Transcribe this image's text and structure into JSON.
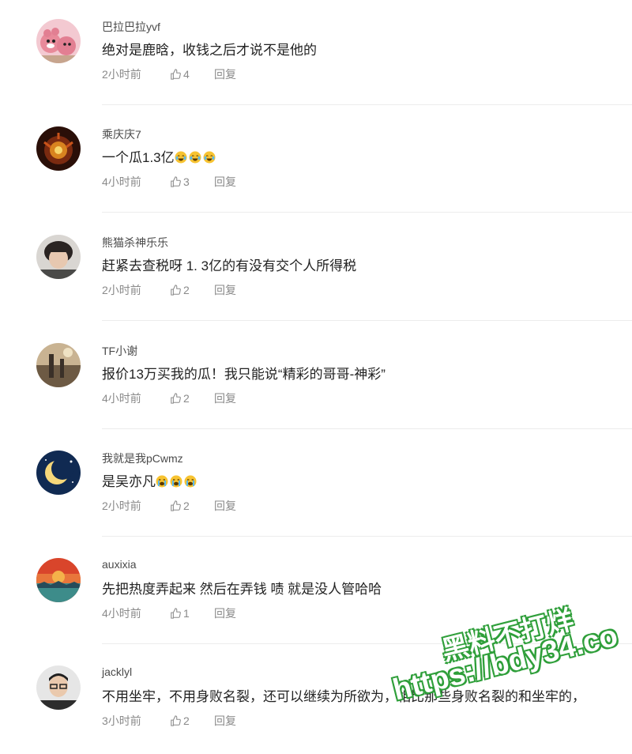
{
  "comments": [
    {
      "username": "巴拉巴拉yvf",
      "text": "绝对是鹿晗，收钱之后才说不是他的",
      "emoji_count": 0,
      "time": "2小时前",
      "likes": "4",
      "reply_label": "回复"
    },
    {
      "username": "乘庆庆7",
      "text": "一个瓜1.3亿",
      "emoji_count": 3,
      "time": "4小时前",
      "likes": "3",
      "reply_label": "回复"
    },
    {
      "username": "熊猫杀神乐乐",
      "text": "赶紧去查税呀 1. 3亿的有没有交个人所得税",
      "emoji_count": 0,
      "time": "2小时前",
      "likes": "2",
      "reply_label": "回复"
    },
    {
      "username": "TF小谢",
      "text": "报价13万买我的瓜！我只能说“精彩的哥哥-神彩”",
      "emoji_count": 0,
      "time": "4小时前",
      "likes": "2",
      "reply_label": "回复"
    },
    {
      "username": "我就是我pCwmz",
      "text": "是吴亦凡",
      "emoji_count": 3,
      "time": "2小时前",
      "likes": "2",
      "reply_label": "回复"
    },
    {
      "username": "auxixia",
      "text": "先把热度弄起来 然后在弄钱 啧 就是没人管哈哈",
      "emoji_count": 0,
      "time": "4小时前",
      "likes": "1",
      "reply_label": "回复"
    },
    {
      "username": "jacklyl",
      "text": "不用坐牢，不用身败名裂，还可以继续为所欲为，相比那些身败名裂的和坐牢的，",
      "emoji_count": 0,
      "time": "3小时前",
      "likes": "2",
      "reply_label": "回复"
    }
  ],
  "watermark": {
    "line1": "黑料不打烊",
    "line2": "https://bdy34.co"
  },
  "colors": {
    "accent_watermark": "#2f9f3a",
    "meta": "#8a8a8a",
    "divider": "#ececec"
  }
}
